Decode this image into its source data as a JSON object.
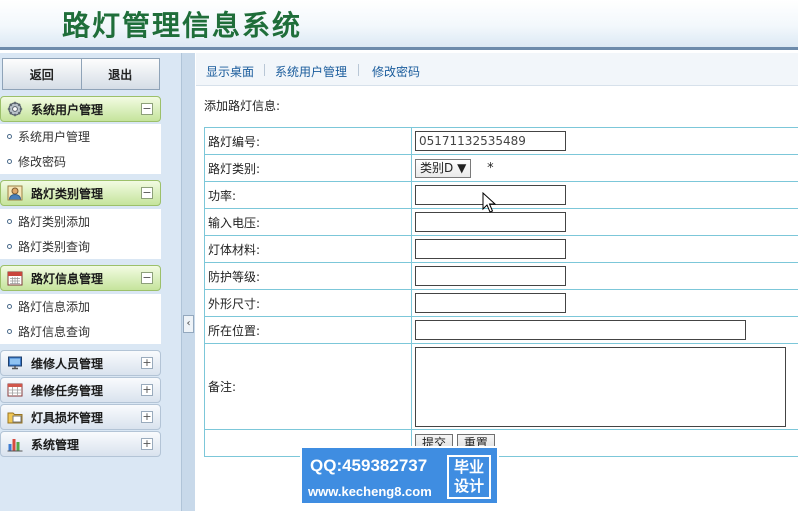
{
  "app": {
    "title": "路灯管理信息系统"
  },
  "sidebar": {
    "back_label": "返回",
    "exit_label": "退出",
    "sections": [
      {
        "label": "系统用户管理",
        "icon": "gear-icon",
        "expanded": true,
        "toggle": "−",
        "items": [
          {
            "label": "系统用户管理"
          },
          {
            "label": "修改密码"
          }
        ]
      },
      {
        "label": "路灯类别管理",
        "icon": "user-icon",
        "expanded": true,
        "toggle": "−",
        "items": [
          {
            "label": "路灯类别添加"
          },
          {
            "label": "路灯类别查询"
          }
        ]
      },
      {
        "label": "路灯信息管理",
        "icon": "calendar-icon",
        "expanded": true,
        "toggle": "−",
        "items": [
          {
            "label": "路灯信息添加"
          },
          {
            "label": "路灯信息查询"
          }
        ]
      },
      {
        "label": "维修人员管理",
        "icon": "computer-icon",
        "expanded": false,
        "toggle": "+"
      },
      {
        "label": "维修任务管理",
        "icon": "table-icon",
        "expanded": false,
        "toggle": "+"
      },
      {
        "label": "灯具损坏管理",
        "icon": "folder-icon",
        "expanded": false,
        "toggle": "+"
      },
      {
        "label": "系统管理",
        "icon": "chart-icon",
        "expanded": false,
        "toggle": "+"
      }
    ],
    "collapse_glyph": "‹"
  },
  "tabs": [
    {
      "label": "显示桌面"
    },
    {
      "label": "系统用户管理"
    },
    {
      "label": "修改密码"
    }
  ],
  "form": {
    "title": "添加路灯信息:",
    "fields": {
      "code": {
        "label": "路灯编号:",
        "value": "05171132535489"
      },
      "category": {
        "label": "路灯类别:",
        "value": "类别D",
        "arrow": "▼",
        "required_mark": "*"
      },
      "power": {
        "label": "功率:",
        "value": ""
      },
      "voltage": {
        "label": "输入电压:",
        "value": ""
      },
      "material": {
        "label": "灯体材料:",
        "value": ""
      },
      "protection": {
        "label": "防护等级:",
        "value": ""
      },
      "size": {
        "label": "外形尺寸:",
        "value": ""
      },
      "location": {
        "label": "所在位置:",
        "value": ""
      },
      "remark": {
        "label": "备注:",
        "value": ""
      }
    },
    "submit_label": "提交",
    "reset_label": "重置"
  },
  "watermark": {
    "qq": "QQ:459382737",
    "url": "www.kecheng8.com",
    "badge_line1": "毕业",
    "badge_line2": "设计"
  },
  "colors": {
    "title_green": "#1f6e3a",
    "open_menu_green": "#c5e49c",
    "table_border": "#7cc7d9",
    "tab_link": "#1a5c9c",
    "sidebar_bg": "#dae7f4",
    "watermark_blue": "#3f8de1"
  }
}
